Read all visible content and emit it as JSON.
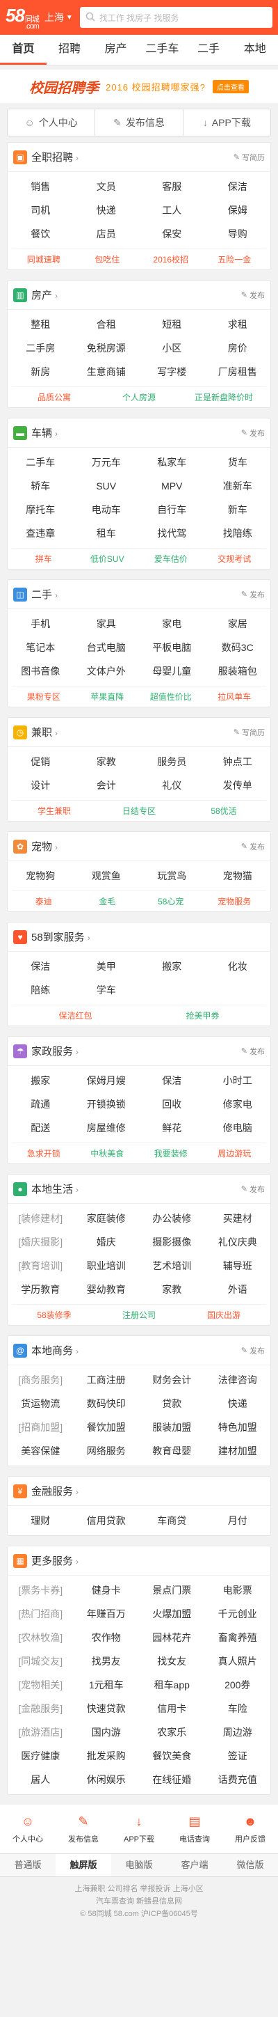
{
  "header": {
    "logo": "58",
    "logo_sub": "同城",
    "logo_dom": ".com",
    "city": "上海",
    "search_placeholder": "找工作 找房子 找服务"
  },
  "topnav": [
    "首页",
    "招聘",
    "房产",
    "二手车",
    "二手",
    "本地"
  ],
  "banner": {
    "title": "校园招聘季",
    "slogan": "2016 校园招聘哪家强?",
    "badge": "点击查看"
  },
  "quick": [
    "个人中心",
    "发布信息",
    "APP下载"
  ],
  "sections": [
    {
      "title": "全职招聘",
      "icon": "briefcase-icon",
      "color": "#ff7f2b",
      "action": "写简历",
      "rows": [
        [
          "销售",
          "文员",
          "客服",
          "保洁"
        ],
        [
          "司机",
          "快递",
          "工人",
          "保姆"
        ],
        [
          "餐饮",
          "店员",
          "保安",
          "导购"
        ]
      ],
      "highlights": [
        [
          "同城速聘",
          "#ff552e"
        ],
        [
          "包吃住",
          "#ff552e"
        ],
        [
          "2016校招",
          "#ff552e"
        ],
        [
          "五险一金",
          "#ff552e"
        ]
      ]
    },
    {
      "title": "房产",
      "icon": "building-icon",
      "color": "#2fb06f",
      "action": "发布",
      "rows": [
        [
          "整租",
          "合租",
          "短租",
          "求租"
        ],
        [
          "二手房",
          "免税房源",
          "小区",
          "房价"
        ],
        [
          "新房",
          "生意商铺",
          "写字楼",
          "厂房租售"
        ]
      ],
      "highlights": [
        [
          "品质公寓",
          "#ff552e"
        ],
        [
          "个人房源",
          "#2fb06f"
        ],
        [
          "正是新盘降价时",
          "#2fb06f"
        ]
      ]
    },
    {
      "title": "车辆",
      "icon": "car-icon",
      "color": "#45b03f",
      "action": "发布",
      "rows": [
        [
          "二手车",
          "万元车",
          "私家车",
          "货车"
        ],
        [
          "轿车",
          "SUV",
          "MPV",
          "准新车"
        ],
        [
          "摩托车",
          "电动车",
          "自行车",
          "新车"
        ],
        [
          "查违章",
          "租车",
          "找代驾",
          "找陪练"
        ]
      ],
      "highlights": [
        [
          "拼车",
          "#ff552e"
        ],
        [
          "低价SUV",
          "#2fb06f"
        ],
        [
          "爱车估价",
          "#2fb06f"
        ],
        [
          "交规考试",
          "#ff552e"
        ]
      ]
    },
    {
      "title": "二手",
      "icon": "cart-icon",
      "color": "#3b8fe0",
      "action": "发布",
      "rows": [
        [
          "手机",
          "家具",
          "家电",
          "家居"
        ],
        [
          "笔记本",
          "台式电脑",
          "平板电脑",
          "数码3C"
        ],
        [
          "图书音像",
          "文体户外",
          "母婴儿童",
          "服装箱包"
        ]
      ],
      "highlights": [
        [
          "果粉专区",
          "#ff552e"
        ],
        [
          "苹果直降",
          "#2fb06f"
        ],
        [
          "超值性价比",
          "#2fb06f"
        ],
        [
          "拉风单车",
          "#ff552e"
        ]
      ]
    },
    {
      "title": "兼职",
      "icon": "clock-icon",
      "color": "#f5b400",
      "action": "写简历",
      "rows": [
        [
          "促销",
          "家教",
          "服务员",
          "钟点工"
        ],
        [
          "设计",
          "会计",
          "礼仪",
          "发传单"
        ]
      ],
      "highlights": [
        [
          "学生兼职",
          "#ff552e"
        ],
        [
          "日结专区",
          "#2fb06f"
        ],
        [
          "58优活",
          "#2fb06f"
        ]
      ]
    },
    {
      "title": "宠物",
      "icon": "paw-icon",
      "color": "#f08b3c",
      "action": "发布",
      "rows": [
        [
          "宠物狗",
          "观赏鱼",
          "玩赏鸟",
          "宠物猫"
        ]
      ],
      "highlights": [
        [
          "泰迪",
          "#ff552e"
        ],
        [
          "金毛",
          "#2fb06f"
        ],
        [
          "58心宠",
          "#2fb06f"
        ],
        [
          "宠物服务",
          "#ff552e"
        ]
      ]
    },
    {
      "title": "58到家服务",
      "icon": "heart-icon",
      "color": "#ff552e",
      "action": "",
      "rows": [
        [
          "保洁",
          "美甲",
          "搬家",
          "化妆"
        ],
        [
          "陪练",
          "学车",
          "",
          ""
        ]
      ],
      "highlights": [
        [
          "保洁红包",
          "#ff552e"
        ],
        [
          "抢美甲券",
          "#2fb06f"
        ]
      ]
    },
    {
      "title": "家政服务",
      "icon": "broom-icon",
      "color": "#a66fd3",
      "action": "发布",
      "rows": [
        [
          "搬家",
          "保姆月嫂",
          "保洁",
          "小时工"
        ],
        [
          "疏通",
          "开锁换锁",
          "回收",
          "修家电"
        ],
        [
          "配送",
          "房屋维修",
          "鲜花",
          "修电脑"
        ]
      ],
      "highlights": [
        [
          "急求开锁",
          "#ff552e"
        ],
        [
          "中秋美食",
          "#2fb06f"
        ],
        [
          "我要装修",
          "#2fb06f"
        ],
        [
          "周边游玩",
          "#ff552e"
        ]
      ]
    },
    {
      "title": "本地生活",
      "icon": "pin-icon",
      "color": "#2fb06f",
      "action": "发布",
      "rows": [
        [
          "[装修建材]",
          "家庭装修",
          "办公装修",
          "买建材"
        ],
        [
          "[婚庆摄影]",
          "婚庆",
          "摄影摄像",
          "礼仪庆典"
        ],
        [
          "[教育培训]",
          "职业培训",
          "艺术培训",
          "辅导班"
        ],
        [
          "学历教育",
          "婴幼教育",
          "家教",
          "外语"
        ]
      ],
      "highlights": [
        [
          "58装修季",
          "#ff552e"
        ],
        [
          "注册公司",
          "#2fb06f"
        ],
        [
          "国庆出游",
          "#ff552e"
        ]
      ]
    },
    {
      "title": "本地商务",
      "icon": "at-icon",
      "color": "#3b8fe0",
      "action": "发布",
      "rows": [
        [
          "[商务服务]",
          "工商注册",
          "财务会计",
          "法律咨询"
        ],
        [
          "货运物流",
          "数码快印",
          "贷款",
          "快递"
        ],
        [
          "[招商加盟]",
          "餐饮加盟",
          "服装加盟",
          "特色加盟"
        ],
        [
          "美容保健",
          "网络服务",
          "教育母婴",
          "建材加盟"
        ]
      ],
      "highlights": []
    },
    {
      "title": "金融服务",
      "icon": "money-icon",
      "color": "#ff7f2b",
      "action": "",
      "rows": [
        [
          "理财",
          "信用贷款",
          "车商贷",
          "月付"
        ]
      ],
      "highlights": []
    },
    {
      "title": "更多服务",
      "icon": "grid-icon",
      "color": "#ff7f2b",
      "action": "",
      "rows": [
        [
          "[票务卡券]",
          "健身卡",
          "景点门票",
          "电影票"
        ],
        [
          "[热门招商]",
          "年赚百万",
          "火爆加盟",
          "千元创业"
        ],
        [
          "[农林牧渔]",
          "农作物",
          "园林花卉",
          "畜禽养殖"
        ],
        [
          "[同城交友]",
          "找男友",
          "找女友",
          "真人照片"
        ],
        [
          "[宠物相关]",
          "1元租车",
          "租车app",
          "200券"
        ],
        [
          "[金融服务]",
          "快速贷款",
          "信用卡",
          "车险"
        ],
        [
          "[旅游酒店]",
          "国内游",
          "农家乐",
          "周边游"
        ],
        [
          "医疗健康",
          "批发采购",
          "餐饮美食",
          "签证"
        ],
        [
          "居人",
          "休闲娱乐",
          "在线征婚",
          "话费充值"
        ]
      ],
      "highlights": []
    }
  ],
  "dock": [
    [
      "个人中心",
      "user-icon"
    ],
    [
      "发布信息",
      "edit-icon"
    ],
    [
      "APP下载",
      "download-icon"
    ],
    [
      "电话查询",
      "trash-icon"
    ],
    [
      "用户反馈",
      "smile-icon"
    ]
  ],
  "versions": [
    "普通版",
    "触屏版",
    "电脑版",
    "客户端",
    "微信版"
  ],
  "footer": {
    "line1": "上海兼职 公司排名  举报投诉  上海小区",
    "line2": "汽车票查询  新赣县信息网",
    "line3": "© 58同城 58.com 沪ICP备06045号"
  }
}
